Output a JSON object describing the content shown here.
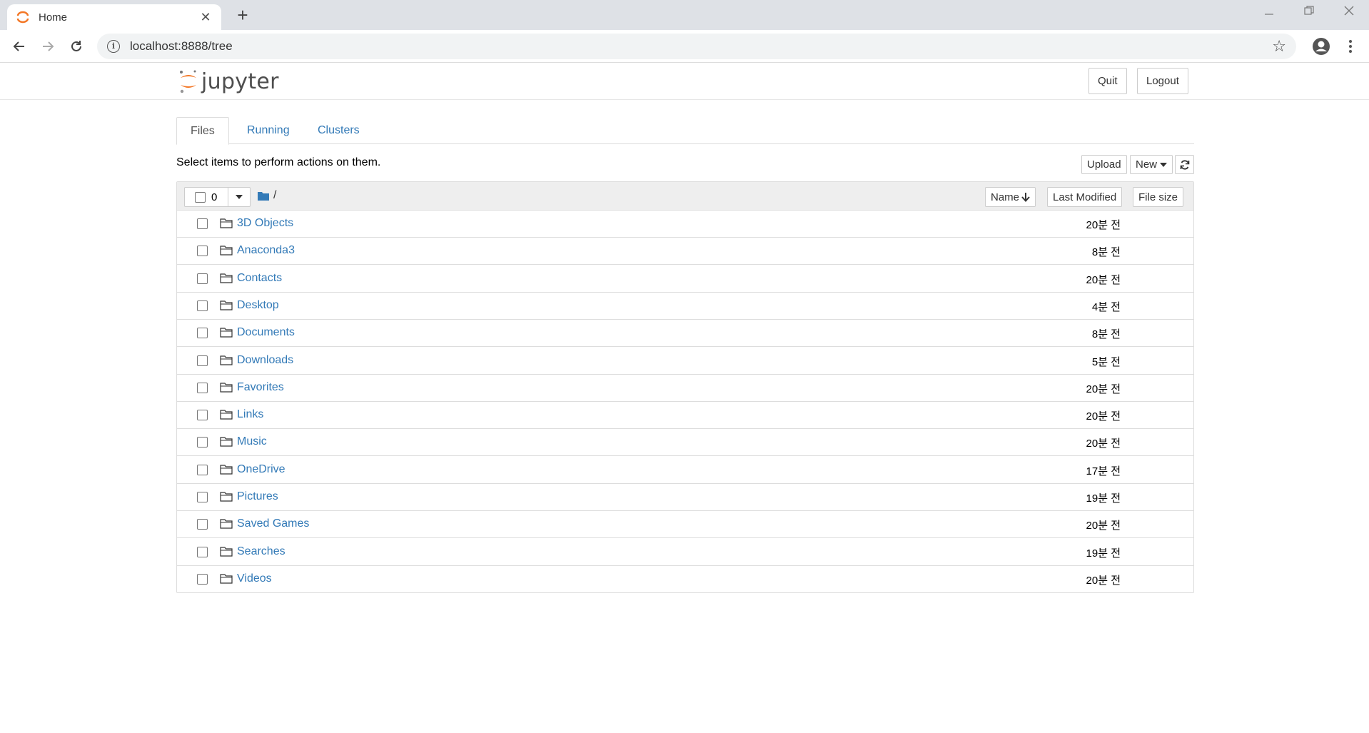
{
  "browser": {
    "tab_title": "Home",
    "url": "localhost:8888/tree",
    "new_tab_glyph": "+",
    "close_glyph": "✕"
  },
  "header": {
    "logo_text": "jupyter",
    "quit_label": "Quit",
    "logout_label": "Logout"
  },
  "tabs": [
    {
      "label": "Files",
      "active": true
    },
    {
      "label": "Running",
      "active": false
    },
    {
      "label": "Clusters",
      "active": false
    }
  ],
  "toolbar": {
    "instructions": "Select items to perform actions on them.",
    "upload_label": "Upload",
    "new_label": "New"
  },
  "list_header": {
    "selected_count": "0",
    "path": "/",
    "sort_name_label": "Name",
    "last_modified_label": "Last Modified",
    "file_size_label": "File size"
  },
  "files": [
    {
      "name": "3D Objects",
      "modified": "20분 전"
    },
    {
      "name": "Anaconda3",
      "modified": "8분 전"
    },
    {
      "name": "Contacts",
      "modified": "20분 전"
    },
    {
      "name": "Desktop",
      "modified": "4분 전"
    },
    {
      "name": "Documents",
      "modified": "8분 전"
    },
    {
      "name": "Downloads",
      "modified": "5분 전"
    },
    {
      "name": "Favorites",
      "modified": "20분 전"
    },
    {
      "name": "Links",
      "modified": "20분 전"
    },
    {
      "name": "Music",
      "modified": "20분 전"
    },
    {
      "name": "OneDrive",
      "modified": "17분 전"
    },
    {
      "name": "Pictures",
      "modified": "19분 전"
    },
    {
      "name": "Saved Games",
      "modified": "20분 전"
    },
    {
      "name": "Searches",
      "modified": "19분 전"
    },
    {
      "name": "Videos",
      "modified": "20분 전"
    }
  ],
  "colors": {
    "link": "#337ab7",
    "jupyter_orange": "#f37726"
  }
}
